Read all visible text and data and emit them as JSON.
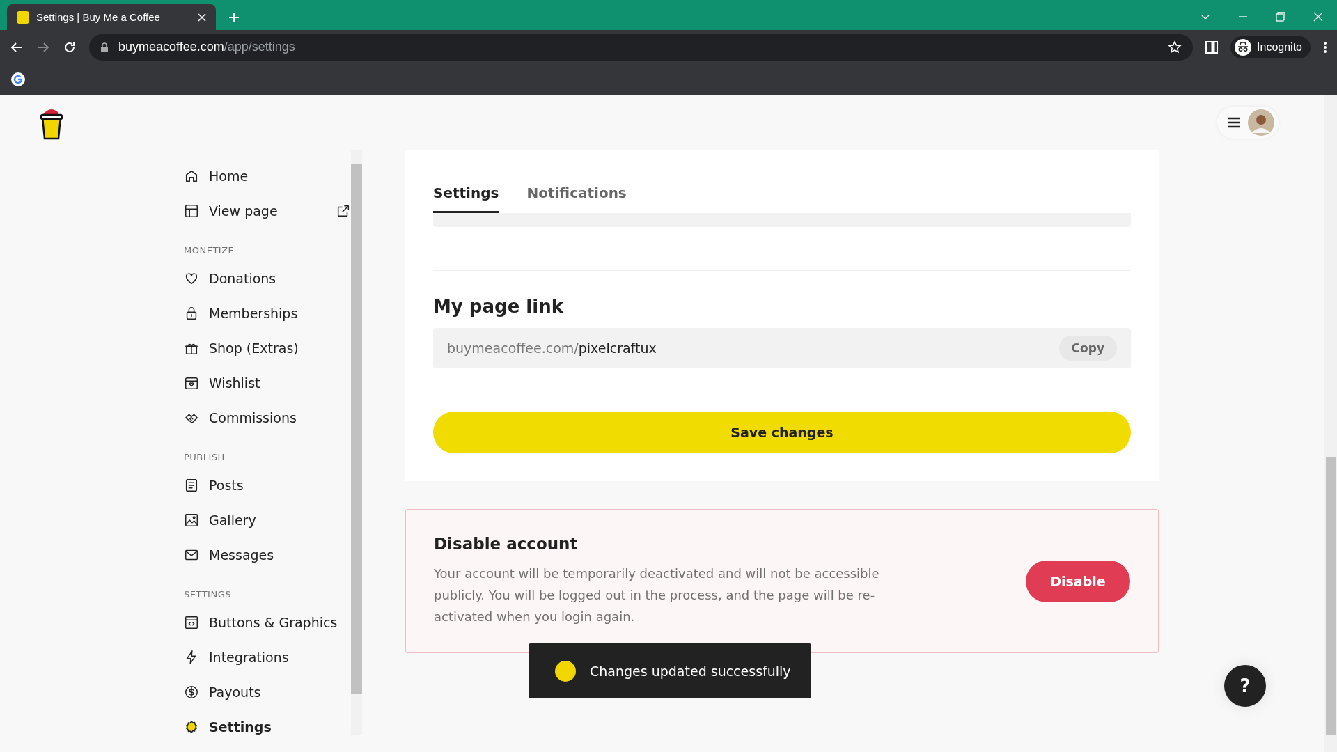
{
  "browser": {
    "tab_title": "Settings | Buy Me a Coffee",
    "url_domain": "buymeacoffee.com",
    "url_path": "/app/settings",
    "profile": "Incognito"
  },
  "sidebar": {
    "items": [
      {
        "kind": "link",
        "label": "Home",
        "selected": false
      },
      {
        "kind": "link",
        "label": "View page",
        "selected": false,
        "external": true
      },
      {
        "kind": "header",
        "label": "MONETIZE"
      },
      {
        "kind": "link",
        "label": "Donations",
        "selected": false
      },
      {
        "kind": "link",
        "label": "Memberships",
        "selected": false
      },
      {
        "kind": "link",
        "label": "Shop (Extras)",
        "selected": false
      },
      {
        "kind": "link",
        "label": "Wishlist",
        "selected": false
      },
      {
        "kind": "link",
        "label": "Commissions",
        "selected": false
      },
      {
        "kind": "header",
        "label": "PUBLISH"
      },
      {
        "kind": "link",
        "label": "Posts",
        "selected": false
      },
      {
        "kind": "link",
        "label": "Gallery",
        "selected": false
      },
      {
        "kind": "link",
        "label": "Messages",
        "selected": false
      },
      {
        "kind": "header",
        "label": "SETTINGS"
      },
      {
        "kind": "link",
        "label": "Buttons & Graphics",
        "selected": false
      },
      {
        "kind": "link",
        "label": "Integrations",
        "selected": false
      },
      {
        "kind": "link",
        "label": "Payouts",
        "selected": false
      },
      {
        "kind": "link",
        "label": "Settings",
        "selected": true
      }
    ]
  },
  "tabs": [
    {
      "label": "Settings",
      "selected": true
    },
    {
      "label": "Notifications",
      "selected": false
    }
  ],
  "page_link": {
    "heading": "My page link",
    "prefix": "buymeacoffee.com/",
    "username": "pixelcraftux",
    "copy_button": "Copy"
  },
  "save_button": "Save changes",
  "disable_account": {
    "heading": "Disable account",
    "body": "Your account will be temporarily deactivated and will not be accessible publicly. You will be logged out in the process, and the page will be re-activated when you login again.",
    "button": "Disable"
  },
  "toast": {
    "message": "Changes updated successfully"
  },
  "help_button": "?"
}
